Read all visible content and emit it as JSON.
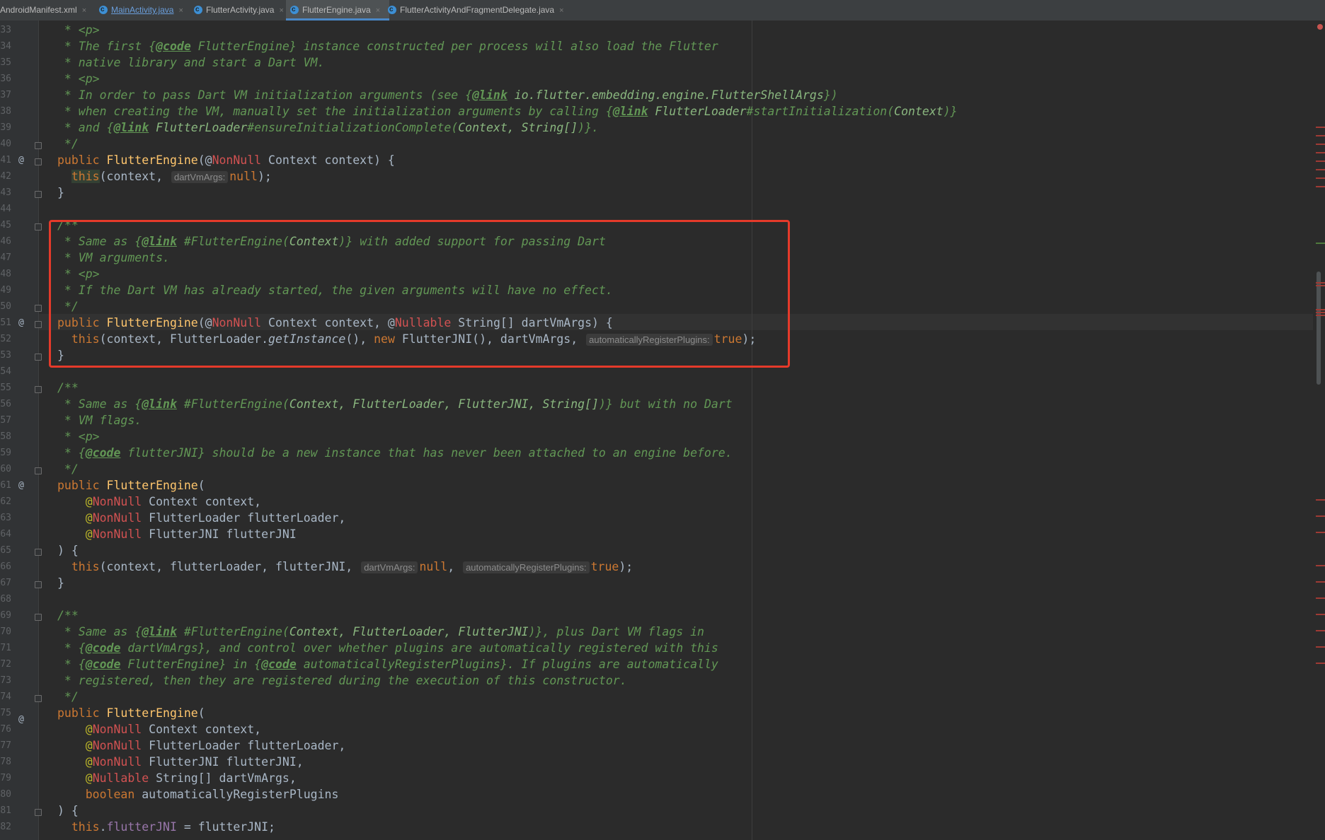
{
  "tabs": [
    {
      "label": "AndroidManifest.xml",
      "icon": "xml-file-icon",
      "active": false,
      "linked": false
    },
    {
      "label": "MainActivity.java",
      "icon": "java-class-icon",
      "active": false,
      "linked": true
    },
    {
      "label": "FlutterActivity.java",
      "icon": "java-class-icon",
      "active": false,
      "linked": false
    },
    {
      "label": "FlutterEngine.java",
      "icon": "java-class-icon",
      "active": true,
      "linked": false
    },
    {
      "label": "FlutterActivityAndFragmentDelegate.java",
      "icon": "java-class-icon",
      "active": false,
      "linked": false
    }
  ],
  "close_glyph": "×",
  "line_numbers": [
    "33",
    "34",
    "35",
    "36",
    "37",
    "38",
    "39",
    "40",
    "41",
    "42",
    "43",
    "44",
    "45",
    "46",
    "47",
    "48",
    "49",
    "50",
    "51",
    "52",
    "53",
    "54",
    "55",
    "56",
    "57",
    "58",
    "59",
    "60",
    "61",
    "62",
    "63",
    "64",
    "65",
    "66",
    "67",
    "68",
    "69",
    "70",
    "71",
    "72",
    "73",
    "74",
    "75",
    "76",
    "77",
    "78",
    "79",
    "80",
    "81",
    "82"
  ],
  "gutter_markers": {
    "at": "@"
  },
  "code": {
    "l33": " * <p>",
    "l34a": " * The first {",
    "l34b": "@code",
    "l34c": " FlutterEngine} instance constructed per process will also load the Flutter",
    "l35": " * native library and start a Dart VM.",
    "l36": " * <p>",
    "l37a": " * In order to pass Dart VM initialization arguments (see {",
    "l37b": "@link",
    "l37c": " io.flutter.embedding.engine.FlutterShellArgs",
    "l37d": "})",
    "l38a": " * when creating the VM, manually set the initialization arguments by calling {",
    "l38b": "@link",
    "l38c": " FlutterLoader",
    "l38d": "#startInitialization(",
    "l38e": "Context",
    "l38f": ")}",
    "l39a": " * and {",
    "l39b": "@link",
    "l39c": " FlutterLoader",
    "l39d": "#ensureInitializationComplete(",
    "l39e": "Context, String[]",
    "l39f": ")}.",
    "l40": " */",
    "kw_public": "public",
    "fn_FlutterEngine": "FlutterEngine",
    "l41a": "(@",
    "ann_NonNull": "NonNull",
    "ann_Nullable": "Nullable",
    "l41b": " Context context) {",
    "kw_this": "this",
    "l42a": "(context, ",
    "hint_dartVmArgs": "dartVmArgs:",
    "hint_autoReg": "automaticallyRegisterPlugins:",
    "kw_null": "null",
    "kw_true": "true",
    "l42b": ");",
    "brace_close": "}",
    "l45": "/**",
    "l46a": " * Same as {",
    "l46b": "@link",
    "l46c": " #FlutterEngine(",
    "l46d": "Context",
    "l46e": ")} with added support for passing Dart",
    "l47": " * VM arguments.",
    "l48": " * <p>",
    "l49": " * If the Dart VM has already started, the given arguments will have no effect.",
    "l50": " */",
    "l51a": "(@",
    "l51b": " Context context, @",
    "l51c": " String[] dartVmArgs) {",
    "l52a": "(context, FlutterLoader.",
    "l52b": "getInstance",
    "l52c": "(), ",
    "kw_new": "new",
    "l52d": " FlutterJNI(), dartVmArgs, ",
    "l52e": ");",
    "l55": "/**",
    "l56a": " * Same as {",
    "l56b": "@link",
    "l56c": " #FlutterEngine(",
    "l56d": "Context, FlutterLoader, FlutterJNI, String[]",
    "l56e": ")} but with no Dart",
    "l57": " * VM flags.",
    "l58": " * <p>",
    "l59a": " * {",
    "l59b": "@code",
    "l59c": " flutterJNI} should be a new instance that has never been attached to an engine before.",
    "l60": " */",
    "l61a": "(",
    "at_sign": "@",
    "l62": " Context context,",
    "l63": " FlutterLoader flutterLoader,",
    "l64": " FlutterJNI flutterJNI",
    "l65": ") {",
    "l66a": "(context, flutterLoader, flutterJNI, ",
    "comma_sp": ", ",
    "l66b": ");",
    "l69": "/**",
    "l70a": " * Same as {",
    "l70b": "@link",
    "l70c": " #FlutterEngine(",
    "l70d": "Context, FlutterLoader, FlutterJNI",
    "l70e": ")}, plus Dart VM flags in",
    "l71a": " * {",
    "l71b": "@code",
    "l71c": " dartVmArgs}, and control over whether plugins are automatically registered with this",
    "l72a": " * {",
    "l72b": "@code",
    "l72c": " FlutterEngine} in {",
    "l72d": "@code",
    "l72e": " automaticallyRegisterPlugins}. If plugins are automatically",
    "l73": " * registered, then they are registered during the execution of this constructor.",
    "l74": " */",
    "l79": " String[] dartVmArgs,",
    "kw_boolean": "boolean",
    "l80": " automaticallyRegisterPlugins",
    "l81": ") {",
    "l82a": ".",
    "fld_flutterJNI": "flutterJNI",
    "l82b": " = flutterJNI;"
  },
  "colors": {
    "highlight_box": "#e53a2a",
    "keyword": "#cc7832",
    "method": "#ffc66d",
    "comment": "#629755",
    "annotation_error": "#d25252",
    "background": "#2b2b2b"
  }
}
